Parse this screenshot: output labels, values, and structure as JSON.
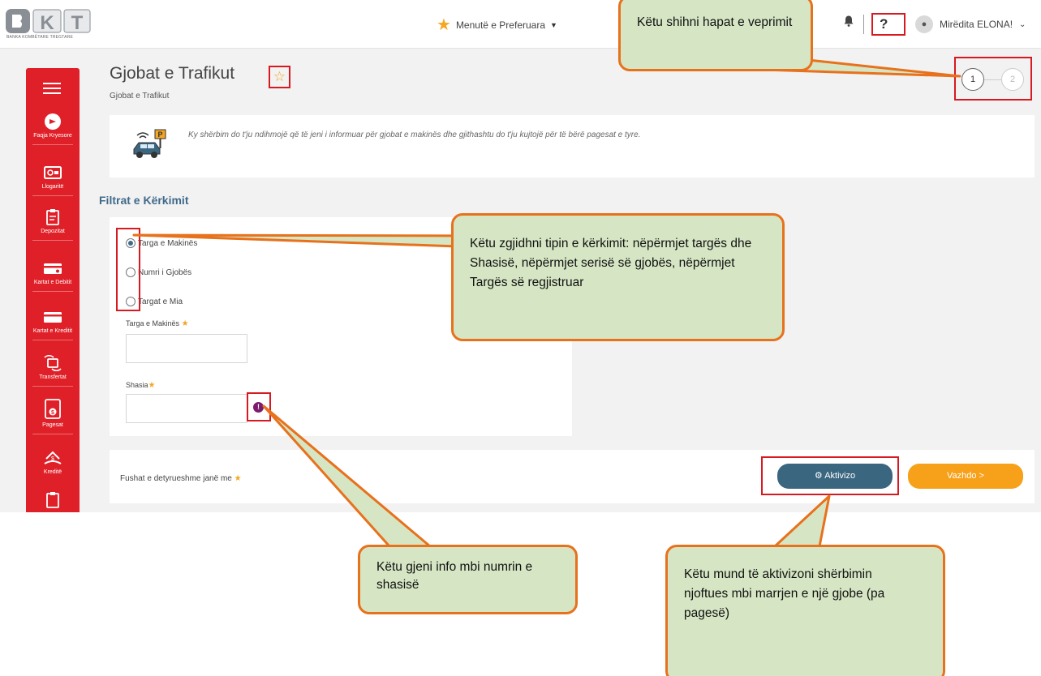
{
  "brand": {
    "logo_text": "BKT",
    "logo_subtitle": "BANKA KOMBËTARE TREGTARE"
  },
  "topbar": {
    "favorites_label": "Menutë e Preferuara",
    "help_label": "?",
    "user_greeting": "Mirëdita ELONA!"
  },
  "sidebar": {
    "items": [
      {
        "label": "Faqja Kryesore",
        "icon": "home-icon"
      },
      {
        "label": "Llogaritë",
        "icon": "accounts-icon"
      },
      {
        "label": "Depozitat",
        "icon": "deposits-icon"
      },
      {
        "label": "Kartat e Debitit",
        "icon": "debit-card-icon"
      },
      {
        "label": "Kartat e Kreditit",
        "icon": "credit-card-icon"
      },
      {
        "label": "Transfertat",
        "icon": "transfers-icon"
      },
      {
        "label": "Pagesat",
        "icon": "payments-icon"
      },
      {
        "label": "Kreditë",
        "icon": "loans-icon"
      }
    ]
  },
  "page": {
    "title": "Gjobat e Trafikut",
    "breadcrumb": "Gjobat e Trafikut",
    "steps": [
      "1",
      "2"
    ],
    "info_text": "Ky shërbim do t'ju ndihmojë që të jeni i informuar për gjobat e makinës dhe gjithashtu do t'ju kujtojë për të bërë pagesat e tyre."
  },
  "filters": {
    "heading": "Filtrat e Kërkimit",
    "options": [
      {
        "label": "Targa e Makinës",
        "selected": true
      },
      {
        "label": "Numri i Gjobës",
        "selected": false
      },
      {
        "label": "Targat e Mia",
        "selected": false
      }
    ],
    "plate_label": "Targa e Makinës",
    "chassis_label": "Shasia",
    "plate_value": "",
    "chassis_value": ""
  },
  "footer": {
    "required_note": "Fushat e detyrueshme janë me",
    "activate_label": "Aktivizo",
    "continue_label": "Vazhdo >"
  },
  "callouts": {
    "steps": "Këtu shihni hapat e veprimit",
    "search_type": "Këtu zgjidhni tipin e kërkimit: nëpërmjet targës dhe Shasisë, nëpërmjet serisë së gjobës, nëpërmjet Targës së regjistruar",
    "chassis_info": "Këtu gjeni info mbi numrin e shasisë",
    "activate": "Këtu mund të aktivizoni shërbimin njoftues mbi marrjen e një gjobe (pa pagesë)"
  },
  "colors": {
    "brand_red": "#e02028",
    "accent_orange": "#f7a11a",
    "primary_blue": "#3b6680",
    "callout_fill": "#d6e6c4",
    "callout_border": "#e8711c",
    "highlight_red": "#d71920"
  }
}
